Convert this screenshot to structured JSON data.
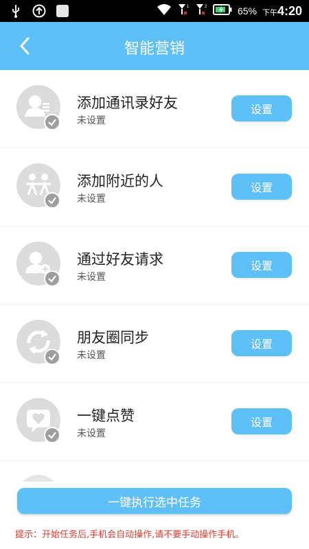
{
  "status_bar": {
    "battery_percent": "65%",
    "time_prefix": "下午",
    "time": "4:20",
    "icons": [
      "usb-icon",
      "upload-icon",
      "app-notification-icon",
      "wifi-icon",
      "signal-sim1-icon",
      "signal-sim2-icon",
      "battery-charging-icon"
    ]
  },
  "header": {
    "title": "智能营销",
    "back_icon": "chevron-left-icon"
  },
  "colors": {
    "accent": "#5ec0f6",
    "avatar_bg": "#dcdcdc",
    "check_badge": "#9e9e9e",
    "tip_text": "#e23b2e"
  },
  "items": [
    {
      "title": "添加通讯录好友",
      "status": "未设置",
      "button": "设置",
      "icon": "contact-list-icon"
    },
    {
      "title": "添加附近的人",
      "status": "未设置",
      "button": "设置",
      "icon": "nearby-people-icon"
    },
    {
      "title": "通过好友请求",
      "status": "未设置",
      "button": "设置",
      "icon": "add-friend-icon"
    },
    {
      "title": "朋友圈同步",
      "status": "未设置",
      "button": "设置",
      "icon": "sync-icon"
    },
    {
      "title": "一键点赞",
      "status": "未设置",
      "button": "设置",
      "icon": "heart-message-icon"
    }
  ],
  "actions": {
    "execute_label": "一键执行选中任务"
  },
  "tip": "提示：开始任务后,手机会自动操作,请不要手动操作手机。"
}
